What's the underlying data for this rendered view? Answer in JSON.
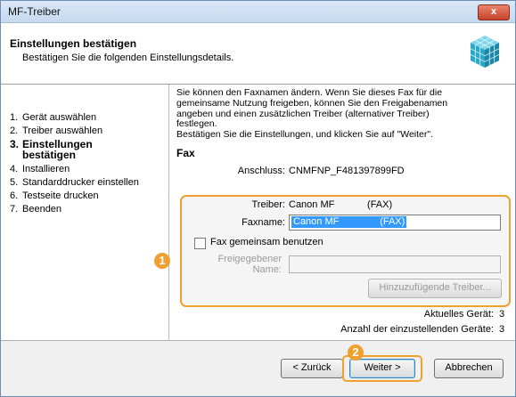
{
  "window": {
    "title": "MF-Treiber",
    "close_label": "x"
  },
  "header": {
    "title": "Einstellungen bestätigen",
    "subtitle": "Bestätigen Sie die folgenden Einstellungsdetails."
  },
  "steps": [
    {
      "num": "1.",
      "label": "Gerät auswählen"
    },
    {
      "num": "2.",
      "label": "Treiber auswählen"
    },
    {
      "num": "3.",
      "label_line1": "Einstellungen",
      "label_line2": "bestätigen"
    },
    {
      "num": "4.",
      "label": "Installieren"
    },
    {
      "num": "5.",
      "label": "Standarddrucker einstellen"
    },
    {
      "num": "6.",
      "label": "Testseite drucken"
    },
    {
      "num": "7.",
      "label": "Beenden"
    }
  ],
  "main": {
    "description_lines": [
      "Sie können den Faxnamen ändern. Wenn Sie dieses Fax für die",
      "gemeinsame Nutzung freigeben, können Sie den Freigabenamen",
      "angeben und einen zusätzlichen Treiber (alternativer Treiber)",
      "festlegen.",
      "Bestätigen Sie die Einstellungen, und klicken Sie auf \"Weiter\"."
    ],
    "section_title": "Fax",
    "anschluss_label": "Anschluss:",
    "anschluss_value": "CNMFNP_F481397899FD",
    "treiber_label": "Treiber:",
    "treiber_value": "Canon MF            (FAX)",
    "faxname_label": "Faxname:",
    "faxname_value": "Canon MF               (FAX)",
    "share_checkbox_label": "Fax gemeinsam benutzen",
    "share_name_label_line1": "Freigegebener",
    "share_name_label_line2": "Name:",
    "add_driver_button": "Hinzuzufügende Treiber...",
    "current_device_label": "Aktuelles Gerät:",
    "current_device_value": "3",
    "device_count_label": "Anzahl der einzustellenden Geräte:",
    "device_count_value": "3"
  },
  "footer": {
    "back_button": "< Zurück",
    "next_button": "Weiter >",
    "cancel_button": "Abbrechen"
  },
  "callouts": {
    "one": "1",
    "two": "2"
  },
  "colors": {
    "accent_orange": "#f0a030",
    "selection_blue": "#3399ff",
    "close_red": "#c7432b"
  }
}
